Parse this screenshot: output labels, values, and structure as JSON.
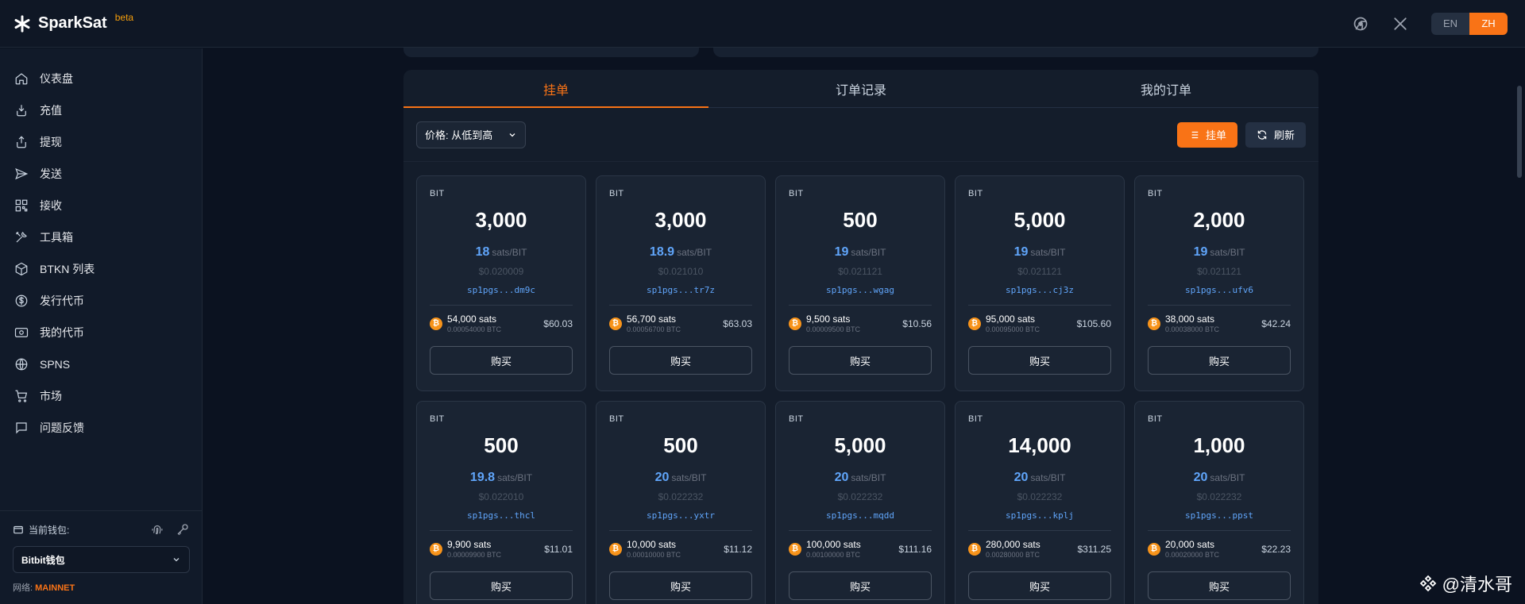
{
  "app": {
    "name": "SparkSat",
    "badge": "beta"
  },
  "header": {
    "lang_en": "EN",
    "lang_zh": "ZH"
  },
  "sidebar": {
    "items": [
      {
        "label": "仪表盘",
        "icon": "home-icon"
      },
      {
        "label": "充值",
        "icon": "deposit-icon"
      },
      {
        "label": "提现",
        "icon": "withdraw-icon"
      },
      {
        "label": "发送",
        "icon": "send-icon"
      },
      {
        "label": "接收",
        "icon": "qr-icon"
      },
      {
        "label": "工具箱",
        "icon": "tools-icon"
      },
      {
        "label": "BTKN 列表",
        "icon": "cube-icon"
      },
      {
        "label": "发行代币",
        "icon": "dollar-icon"
      },
      {
        "label": "我的代币",
        "icon": "wallet-card-icon"
      },
      {
        "label": "SPNS",
        "icon": "globe-icon"
      },
      {
        "label": "市场",
        "icon": "cart-icon"
      },
      {
        "label": "问题反馈",
        "icon": "chat-icon"
      }
    ],
    "wallet_label": "当前钱包:",
    "wallet_value": "Bitbit钱包",
    "network_label": "网络:",
    "network_value": "MAINNET"
  },
  "market": {
    "tabs": [
      "挂单",
      "订单记录",
      "我的订单"
    ],
    "sort_label": "价格: 从低到高",
    "list_button": "挂单",
    "refresh_button": "刷新",
    "buy_label": "购买",
    "unit": "sats/BIT",
    "listings": [
      {
        "ticker": "BIT",
        "amount": "3,000",
        "price": "18",
        "usd_price": "$0.020009",
        "addr": "sp1pgs...dm9c",
        "sats": "54,000 sats",
        "btc": "0.00054000 BTC",
        "total": "$60.03"
      },
      {
        "ticker": "BIT",
        "amount": "3,000",
        "price": "18.9",
        "usd_price": "$0.021010",
        "addr": "sp1pgs...tr7z",
        "sats": "56,700 sats",
        "btc": "0.00056700 BTC",
        "total": "$63.03"
      },
      {
        "ticker": "BIT",
        "amount": "500",
        "price": "19",
        "usd_price": "$0.021121",
        "addr": "sp1pgs...wgag",
        "sats": "9,500 sats",
        "btc": "0.00009500 BTC",
        "total": "$10.56"
      },
      {
        "ticker": "BIT",
        "amount": "5,000",
        "price": "19",
        "usd_price": "$0.021121",
        "addr": "sp1pgs...cj3z",
        "sats": "95,000 sats",
        "btc": "0.00095000 BTC",
        "total": "$105.60"
      },
      {
        "ticker": "BIT",
        "amount": "2,000",
        "price": "19",
        "usd_price": "$0.021121",
        "addr": "sp1pgs...ufv6",
        "sats": "38,000 sats",
        "btc": "0.00038000 BTC",
        "total": "$42.24"
      },
      {
        "ticker": "BIT",
        "amount": "500",
        "price": "19.8",
        "usd_price": "$0.022010",
        "addr": "sp1pgs...thcl",
        "sats": "9,900 sats",
        "btc": "0.00009900 BTC",
        "total": "$11.01"
      },
      {
        "ticker": "BIT",
        "amount": "500",
        "price": "20",
        "usd_price": "$0.022232",
        "addr": "sp1pgs...yxtr",
        "sats": "10,000 sats",
        "btc": "0.00010000 BTC",
        "total": "$11.12"
      },
      {
        "ticker": "BIT",
        "amount": "5,000",
        "price": "20",
        "usd_price": "$0.022232",
        "addr": "sp1pgs...mqdd",
        "sats": "100,000 sats",
        "btc": "0.00100000 BTC",
        "total": "$111.16"
      },
      {
        "ticker": "BIT",
        "amount": "14,000",
        "price": "20",
        "usd_price": "$0.022232",
        "addr": "sp1pgs...kplj",
        "sats": "280,000 sats",
        "btc": "0.00280000 BTC",
        "total": "$311.25"
      },
      {
        "ticker": "BIT",
        "amount": "1,000",
        "price": "20",
        "usd_price": "$0.022232",
        "addr": "sp1pgs...ppst",
        "sats": "20,000 sats",
        "btc": "0.00020000 BTC",
        "total": "$22.23"
      }
    ]
  },
  "watermark": "@清水哥",
  "colors": {
    "accent": "#f97316",
    "price_blue": "#60a5fa",
    "background": "#0b1220"
  }
}
